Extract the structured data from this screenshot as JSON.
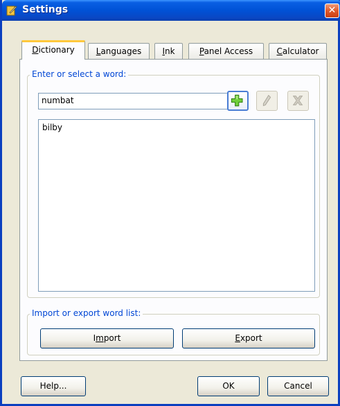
{
  "window": {
    "title": "Settings"
  },
  "tabs": [
    {
      "label": "Dictionary",
      "accel": "D",
      "rest": "ictionary"
    },
    {
      "label": "Languages",
      "accel": "L",
      "rest": "anguages"
    },
    {
      "label": "Ink",
      "accel": "I",
      "rest": "nk"
    },
    {
      "label": "Panel Access",
      "accel": "P",
      "rest": "anel Access"
    },
    {
      "label": "Calculator",
      "accel": "C",
      "rest": "alculator"
    }
  ],
  "dictionary": {
    "group_label": "Enter or select a word:",
    "word_input_value": "numbat",
    "words": [
      "bilby"
    ],
    "import_export_label": "Import or export word list:",
    "import_label": {
      "pre": "I",
      "accel": "m",
      "post": "port"
    },
    "export_label": {
      "pre": "",
      "accel": "E",
      "post": "xport"
    }
  },
  "footer": {
    "help_label": "Help...",
    "ok_label": "OK",
    "cancel_label": "Cancel"
  },
  "icons": {
    "add": "plus-icon",
    "edit": "pencil-icon",
    "delete": "x-icon"
  },
  "colors": {
    "titlebar": "#0052d6",
    "group_label": "#0046d5",
    "active_tab_highlight": "#ffc83c"
  }
}
